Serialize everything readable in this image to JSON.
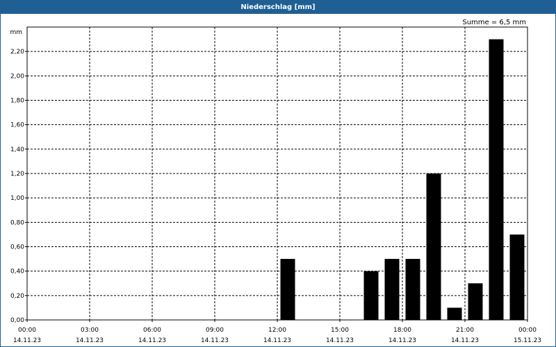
{
  "window": {
    "title": "Niederschlag [mm]"
  },
  "summary": "Summe = 6,5 mm",
  "colors": {
    "titlebar": "#1f5f94",
    "bar": "#000000",
    "grid": "#000000"
  },
  "chart_data": {
    "type": "bar",
    "title": "Niederschlag [mm]",
    "ylabel": "mm",
    "xlabel": "",
    "ylim": [
      0,
      2.4
    ],
    "yticks": [
      "0,00",
      "0,20",
      "0,40",
      "0,60",
      "0,80",
      "1,00",
      "1,20",
      "1,40",
      "1,60",
      "1,80",
      "2,00",
      "2,20"
    ],
    "xticks": [
      {
        "time": "00:00",
        "date": "14.11.23"
      },
      {
        "time": "03:00",
        "date": "14.11.23"
      },
      {
        "time": "06:00",
        "date": "14.11.23"
      },
      {
        "time": "09:00",
        "date": "14.11.23"
      },
      {
        "time": "12:00",
        "date": "14.11.23"
      },
      {
        "time": "15:00",
        "date": "14.11.23"
      },
      {
        "time": "18:00",
        "date": "14.11.23"
      },
      {
        "time": "21:00",
        "date": "14.11.23"
      },
      {
        "time": "00:00",
        "date": "15.11.23"
      }
    ],
    "x_hours": [
      12,
      16,
      17,
      18,
      19,
      20,
      21,
      22,
      23
    ],
    "values": [
      0.5,
      0.4,
      0.5,
      0.5,
      1.2,
      0.1,
      0.3,
      2.3,
      0.7
    ],
    "grid": true,
    "total": 6.5
  }
}
